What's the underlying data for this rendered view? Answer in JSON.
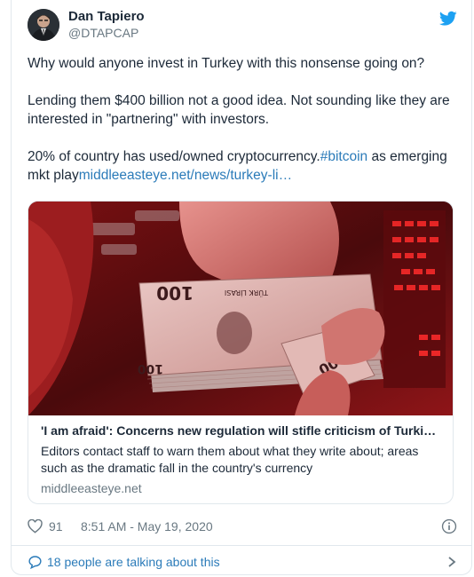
{
  "author": {
    "display_name": "Dan Tapiero",
    "handle": "@DTAPCAP"
  },
  "tweet": {
    "line1": "Why would anyone invest in Turkey with this nonsense going on?",
    "line2": "Lending them $400 billion not a good idea. Not sounding like they are interested in \"partnering\" with investors.",
    "line3_prefix": "20% of country has used/owned cryptocurrency.",
    "hashtag": "#bitcoin",
    "line3_middle": " as emerging mkt play",
    "link": "middleeasteye.net/news/turkey-li…"
  },
  "link_card": {
    "banknote_text_1": "100",
    "banknote_text_2": "100",
    "banknote_text_3": "100",
    "banknote_text_4": "100",
    "banknote_header": "TÜRK LİRASI",
    "title": "'I am afraid': Concerns new regulation will stifle criticism of Turkis…",
    "description": "Editors contact staff to warn them about what they write about; areas such as the dramatic fall in the country's currency",
    "domain": "middleeasteye.net"
  },
  "meta": {
    "likes": "91",
    "timestamp": "8:51 AM - May 19, 2020"
  },
  "footer": {
    "talking_label": "18 people are talking about this"
  },
  "colors": {
    "link": "#2b7bb9",
    "twitter_blue": "#1da1f2",
    "secondary_text": "#697882"
  }
}
